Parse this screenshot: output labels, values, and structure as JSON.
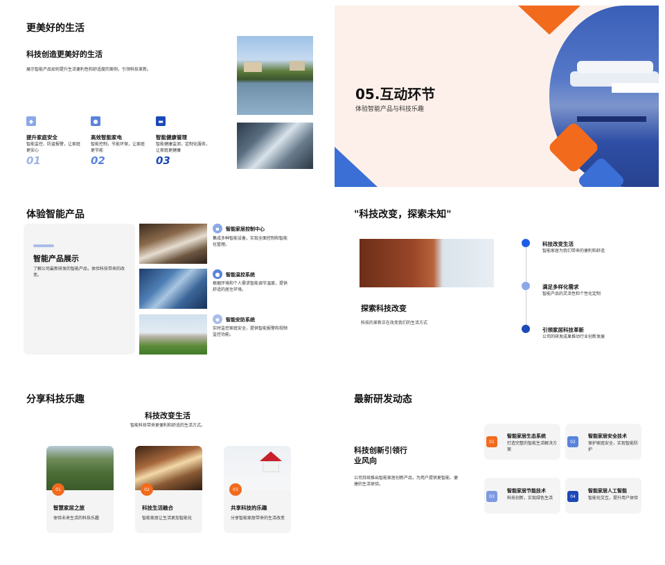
{
  "s1": {
    "title": "更美好的生活",
    "subtitle": "科技创造更美好的生活",
    "desc": "展示智能产品如何提升生活便利性和舒适度的案例，引领科技革新。",
    "features": [
      {
        "title": "提升家庭安全",
        "desc": "智能监控、防盗报警，让家庭更安心",
        "num": "01"
      },
      {
        "title": "高效智能家电",
        "desc": "智能控制，节能环保，让家庭更节能",
        "num": "02"
      },
      {
        "title": "智能健康管理",
        "desc": "智能健康监测，定制化服务，让家庭更健康",
        "num": "03"
      }
    ]
  },
  "s2": {
    "title": "05.互动环节",
    "subtitle": "体验智能产品与科技乐趣"
  },
  "s3": {
    "title": "体验智能产品",
    "card_title": "智能产品展示",
    "card_desc": "了解公司最新研发的智能产品，体验科技带来的改变。",
    "items": [
      {
        "title": "智能家居控制中心",
        "desc": "集成多种智能设备，实现全面控制和智能化管理。"
      },
      {
        "title": "智能温控系统",
        "desc": "根据环境和个人需求智能调节温度，提供舒适的居住环境。"
      },
      {
        "title": "智能安防系统",
        "desc": "实时监控家庭安全，提供智能报警和视频监控功能。"
      }
    ]
  },
  "s4": {
    "title": "\"科技改变，探索未知\"",
    "sub": "探索科技改变",
    "desc": "科技的革新正在改变我们的生活方式",
    "timeline": [
      {
        "title": "科技改变生活",
        "desc": "智能家居为我们带来的便利和舒适"
      },
      {
        "title": "满足多样化需求",
        "desc": "智能产品的灵活性和个性化定制"
      },
      {
        "title": "引领家居科技革新",
        "desc": "公司的研发成果推动行业创新发展"
      }
    ]
  },
  "s5": {
    "title": "分享科技乐趣",
    "sub": "科技改变生活",
    "desc": "智能科技带来更便利和舒适的生活方式。",
    "cards": [
      {
        "num": "01",
        "title": "智慧家居之旅",
        "desc": "体验未来生活的科技乐趣"
      },
      {
        "num": "02",
        "title": "科技生活融合",
        "desc": "智能家居让生活更加智能化"
      },
      {
        "num": "03",
        "title": "共享科技的乐趣",
        "desc": "分享智能家居带来的生活改变"
      }
    ]
  },
  "s6": {
    "title": "最新研发动态",
    "main_line1": "科技创新引领行",
    "main_line2": "业风向",
    "desc": "公司持续推出智能家居创新产品，为用户提供更智能、便捷的生活体验。",
    "items": [
      {
        "num": "01",
        "title": "智能家居生态系统",
        "desc": "打造完整的智能生活解决方案"
      },
      {
        "num": "02",
        "title": "智能家居安全技术",
        "desc": "保护家庭安全，实现智能防护"
      },
      {
        "num": "03",
        "title": "智能家居节能技术",
        "desc": "科技创新，实现绿色生活"
      },
      {
        "num": "04",
        "title": "智能家居人工智能",
        "desc": "智能化交互，提升用户体验"
      }
    ]
  },
  "colors": {
    "accent_blue": "#3b6fd6",
    "accent_orange": "#f26b1d",
    "peach": "#fdf0ea"
  }
}
